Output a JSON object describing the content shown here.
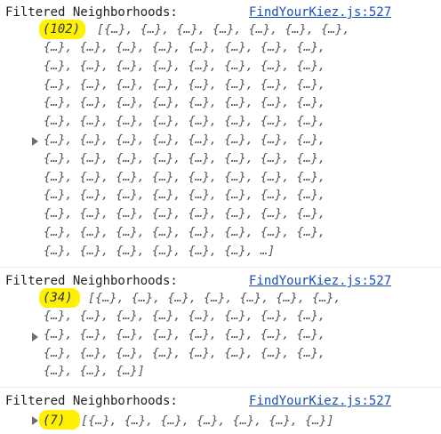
{
  "logs": [
    {
      "message": "Filtered Neighborhoods:",
      "source": "FindYourKiez.js:527",
      "count": "(102)",
      "first_line": "[{…}, {…}, {…}, {…}, {…}, {…}, {…},",
      "lines": [
        "{…}, {…}, {…}, {…}, {…}, {…}, {…}, {…},",
        "{…}, {…}, {…}, {…}, {…}, {…}, {…}, {…},",
        "{…}, {…}, {…}, {…}, {…}, {…}, {…}, {…},",
        "{…}, {…}, {…}, {…}, {…}, {…}, {…}, {…},",
        "{…}, {…}, {…}, {…}, {…}, {…}, {…}, {…},",
        "{…}, {…}, {…}, {…}, {…}, {…}, {…}, {…},",
        "{…}, {…}, {…}, {…}, {…}, {…}, {…}, {…},",
        "{…}, {…}, {…}, {…}, {…}, {…}, {…}, {…},",
        "{…}, {…}, {…}, {…}, {…}, {…}, {…}, {…},",
        "{…}, {…}, {…}, {…}, {…}, {…}, {…}, {…},",
        "{…}, {…}, {…}, {…}, {…}, {…}, {…}, {…},",
        "{…}, {…}, {…}, {…}, {…}, {…}, …]"
      ]
    },
    {
      "message": "Filtered Neighborhoods:",
      "source": "FindYourKiez.js:527",
      "count": "(34)",
      "first_line": "[{…}, {…}, {…}, {…}, {…}, {…}, {…},",
      "lines": [
        "{…}, {…}, {…}, {…}, {…}, {…}, {…}, {…},",
        "{…}, {…}, {…}, {…}, {…}, {…}, {…}, {…},",
        "{…}, {…}, {…}, {…}, {…}, {…}, {…}, {…},",
        "{…}, {…}, {…}]"
      ]
    },
    {
      "message": "Filtered Neighborhoods:",
      "source": "FindYourKiez.js:527",
      "count": "(7)",
      "first_line": "[{…}, {…}, {…}, {…}, {…}, {…}, {…}]",
      "lines": []
    }
  ]
}
